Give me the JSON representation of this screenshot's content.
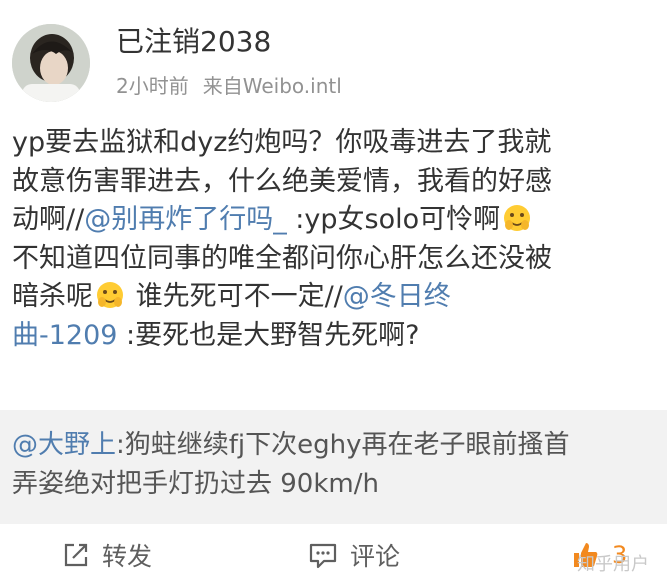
{
  "user": {
    "name": "已注销2038",
    "time": "2小时前",
    "source": "来自Weibo.intl"
  },
  "post": {
    "l1": "yp要去监狱和dyz约炮吗？你吸毒进去了我就",
    "l2": "故意伤害罪进去，什么绝美爱情，我看的好感",
    "l3a": "动啊//",
    "l3m": "@别再炸了行吗_",
    "l3b": " :yp女solo可怜啊",
    "l4": "不知道四位同事的唯全都问你心肝怎么还没被",
    "l5a": "暗杀呢",
    "l5b": " 谁先死可不一定//",
    "l5m": "@冬日终",
    "l6m": "曲-1209",
    "l6b": " :要死也是大野智先死啊?"
  },
  "repost": {
    "mention": "@大野上",
    "l1": ":狗蛀继续fj下次eghy再在老子眼前搔首",
    "l2": "弄姿绝对把手灯扔过去 90km/h"
  },
  "actions": {
    "repost_label": "转发",
    "comment_label": "评论",
    "like_count": "3"
  },
  "watermark": "知乎用户",
  "icons": {
    "repost": "share-arrow-icon",
    "comment": "speech-bubble-icon",
    "like": "thumbs-up-icon",
    "emoji": "hiding-face-emoji"
  },
  "colors": {
    "mention": "#507daf",
    "meta": "#929292",
    "repost_bg": "#f2f2f2",
    "like": "#f2891f"
  }
}
